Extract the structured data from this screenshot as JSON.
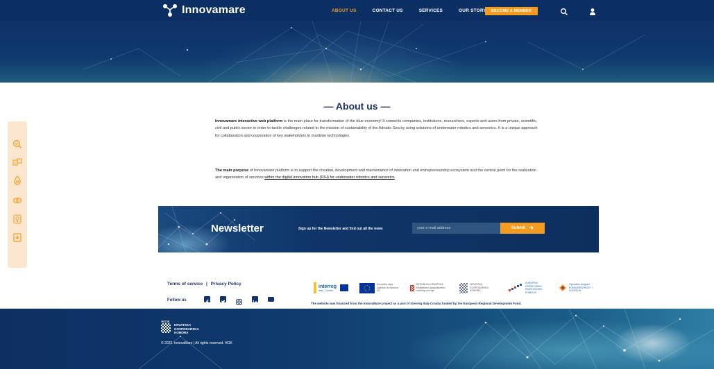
{
  "header": {
    "logo_text": "Innovamare",
    "nav": [
      "ABOUT US",
      "CONTACT US",
      "SERVICES",
      "OUR STORY"
    ],
    "become_member": "BECOME A MEMBER"
  },
  "about": {
    "title": "— About us —",
    "p1_bold": "Innovamare interactive web platform",
    "p1_rest": " is the main place for transformation of the blue economy! It connects companies, institutions, researchers, experts and users from private, scientific, civil and public sector in order to tackle challenges related to the mission of sustainability of the Adriatic Sea by using solutions of underwater robotics and sensorics. It is a unique approach for collaboration and cooperation of key stakeholders in maritime technologies.",
    "p2_bold": "The main purpose",
    "p2_rest": " of Innovamare platform is to support the creation, development and maintenance of innovation and entrepreneurship ecosystem and the central point for the realization and organization of services ",
    "p2_link": "within the digital innovation hub (DIH) for underwater robotics and sensorics",
    "p2_end": "."
  },
  "newsletter": {
    "title": "Newsletter",
    "text": "Sign up for the Newsletter and find out all the news",
    "placeholder": "your e-mail address",
    "submit": "Submit"
  },
  "footer": {
    "terms": "Terms of service",
    "separator": "|",
    "privacy": "Privacy Policy",
    "follow": "Follow us",
    "funding": "The website was financed from the InnovaMare project as a part of Interreg Italy-Croatia funded by the European Regional Development Fund.",
    "sponsors": {
      "interreg": "interreg",
      "interreg_sub": "Italy - Croatia",
      "eu": "Europska unija Zajedno do fondova EU",
      "croatia": "REPUBLIKA HRVATSKA Ministarstvo gospodarstva i održivog razvoja",
      "hgk": "HRVATSKA GOSPODARSKA KOMORA",
      "funds": "EUROPSKI STRUKTURNI I INVESTICIJSKI FONDOVI",
      "op": "Operativni program KONKURENTNOST I KOHEZIJA"
    },
    "hgk_short": "HGK",
    "hgk_lines": [
      "HRVATSKA",
      "GOSPODARSKA",
      "KOMORA"
    ],
    "copyright": "© 2022. InnovaMare | All rights reserved. HGK"
  },
  "colors": {
    "navy": "#0b2f63",
    "accent": "#f39c1f",
    "sidebar_bg": "#fbe7cf"
  },
  "icons": {
    "header": [
      "search-icon",
      "user-icon"
    ],
    "sidebar": [
      "search-icon",
      "chat-icon",
      "drop-icon",
      "link-icon",
      "bulb-icon",
      "download-icon"
    ],
    "social": [
      "facebook-icon",
      "twitter-icon",
      "instagram-icon",
      "linkedin-icon",
      "youtube-icon"
    ]
  }
}
